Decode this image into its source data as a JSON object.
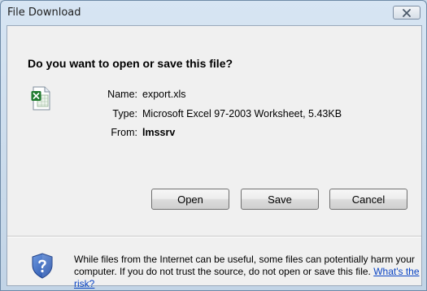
{
  "window": {
    "title": "File Download"
  },
  "dialog": {
    "question": "Do you want to open or save this file?",
    "file": {
      "name_label": "Name:",
      "name_value": "export.xls",
      "type_label": "Type:",
      "type_value": "Microsoft Excel 97-2003 Worksheet, 5.43KB",
      "from_label": "From:",
      "from_value": "lmssrv"
    },
    "buttons": {
      "open": "Open",
      "save": "Save",
      "cancel": "Cancel"
    },
    "warning": {
      "text": "While files from the Internet can be useful, some files can potentially harm your computer. If you do not trust the source, do not open or save this file.",
      "link": "What's the risk?"
    }
  },
  "icons": {
    "close": "close-icon",
    "file": "excel-file-icon",
    "shield": "security-shield-icon"
  },
  "colors": {
    "link": "#0a44c4",
    "excel_green": "#1f7a2e",
    "shield_blue": "#2a5bb5"
  }
}
